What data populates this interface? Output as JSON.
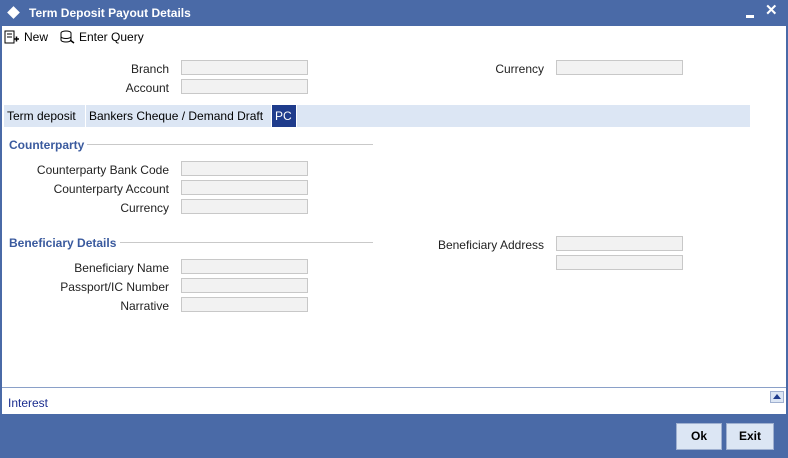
{
  "window": {
    "title": "Term Deposit Payout Details"
  },
  "toolbar": {
    "new_label": "New",
    "enter_query_label": "Enter Query"
  },
  "header": {
    "branch_label": "Branch",
    "account_label": "Account",
    "currency_label": "Currency"
  },
  "tabs": [
    {
      "label": "Term deposit"
    },
    {
      "label": "Bankers Cheque / Demand Draft"
    },
    {
      "label": "PC",
      "active": true
    }
  ],
  "counterparty": {
    "title": "Counterparty",
    "bank_code_label": "Counterparty Bank Code",
    "account_label": "Counterparty Account",
    "currency_label": "Currency"
  },
  "beneficiary": {
    "title": "Beneficiary Details",
    "name_label": "Beneficiary Name",
    "passport_label": "Passport/IC Number",
    "narrative_label": "Narrative",
    "address_label": "Beneficiary Address"
  },
  "bottom": {
    "interest_label": "Interest"
  },
  "footer": {
    "ok_label": "Ok",
    "exit_label": "Exit"
  },
  "colors": {
    "frame": "#4a6aa7",
    "tab_active": "#1f3c8c",
    "tab_bar": "#dce6f4",
    "section_title": "#3a5a9e"
  }
}
